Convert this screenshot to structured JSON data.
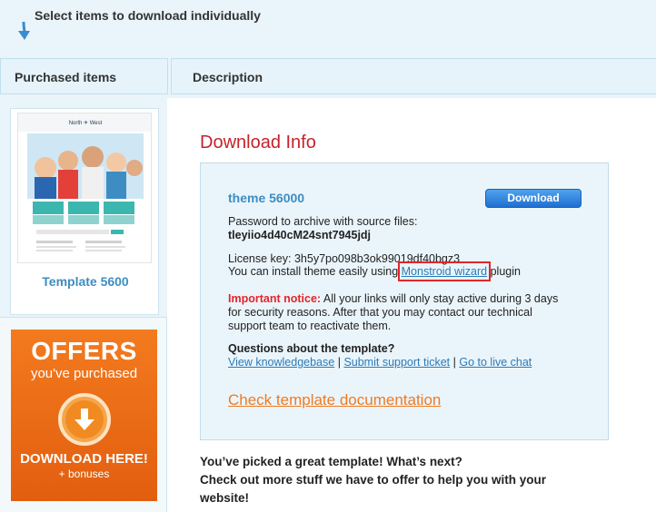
{
  "header": {
    "title": "Select items to download individually"
  },
  "tabs": [
    {
      "label": "Purchased items"
    },
    {
      "label": "Description"
    }
  ],
  "left": {
    "template_label": "Template 5600",
    "thumb_brand": "North ✈ West",
    "offers": {
      "title": "OFFERS",
      "subtitle": "you've purchased",
      "download": "DOWNLOAD HERE!",
      "bonus": "+ bonuses"
    }
  },
  "main": {
    "heading": "Download Info",
    "theme_name": "theme 56000",
    "download_button": "Download",
    "password_label": "Password to archive with source files:",
    "password_value": "tleyiio4d40cM24snt7945jdj",
    "license_label": "License key:",
    "license_value": "3h5y7po098b3ok99019df40bgz3",
    "install_prefix": "You can install theme easily using",
    "install_link": "Monstroid wizard",
    "install_suffix": "plugin",
    "notice_label": "Important notice:",
    "notice_line1": "All your links will only stay active during 3 days",
    "notice_line2": "for security reasons. After that you may contact our technical",
    "notice_line3": "support team to reactivate them.",
    "questions_label": "Questions about the template?",
    "link_kb": "View knowledgebase",
    "link_ticket": "Submit support ticket",
    "link_chat": "Go to live chat",
    "separator": "|",
    "check_doc": "Check template documentation",
    "next_line1": "You’ve picked a great template! What’s next?",
    "next_line2": "Check out more stuff we have to offer to help you with your",
    "next_line3": "website!"
  },
  "colors": {
    "accent_blue": "#3d8dc2",
    "heading_red": "#c6222a",
    "orange": "#f07a22",
    "highlight_red": "#e4252b"
  }
}
